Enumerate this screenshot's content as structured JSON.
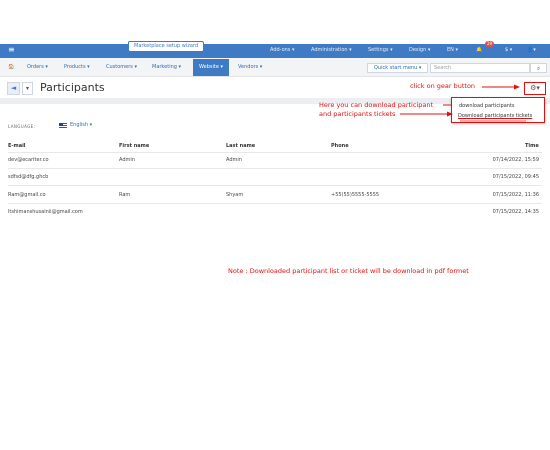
{
  "topbar": {
    "wizard": "Marketplace setup wizard",
    "menus": [
      "Add-ons ▾",
      "Administration ▾",
      "Settings ▾",
      "Design ▾",
      "EN ▾",
      "$ ▾"
    ],
    "notification_count": "29"
  },
  "nav": {
    "items": [
      "Orders ▾",
      "Products ▾",
      "Customers ▾",
      "Marketing ▾",
      "Website ▾",
      "Vendors ▾"
    ],
    "active": "Website ▾",
    "quick_start": "Quick start menu ▾",
    "search_placeholder": "Search"
  },
  "page": {
    "title": "Participants"
  },
  "gear_menu": {
    "items": [
      "download participants",
      "Download participants tickets"
    ]
  },
  "annotations": {
    "gear_hint": "click on gear button",
    "download_hint_line1": "Here you can download participant",
    "download_hint_line2": "and participants tickets",
    "note": "Note : Downloaded participant list or ticket will be download in pdf formet"
  },
  "language": {
    "label": "LANGUAGE:",
    "value": "English ▾"
  },
  "table": {
    "headers": [
      "E-mail",
      "First name",
      "Last name",
      "Phone",
      "Time"
    ],
    "rows": [
      {
        "email": "dev@ecariter.co",
        "first": "Admin",
        "last": "Admin",
        "phone": "",
        "time": "07/14/2022, 15:59"
      },
      {
        "email": "sdfsd@dfg.ghcb",
        "first": "",
        "last": "",
        "phone": "",
        "time": "07/15/2022, 09:45"
      },
      {
        "email": "Ram@gmail.co",
        "first": "Ram",
        "last": "Shyam",
        "phone": "+55(55)5555-5555",
        "time": "07/15/2022, 11:36"
      },
      {
        "email": "ltshimanshusainii@gmail.com",
        "first": "",
        "last": "",
        "phone": "",
        "time": "07/15/2022, 14:35"
      }
    ]
  }
}
